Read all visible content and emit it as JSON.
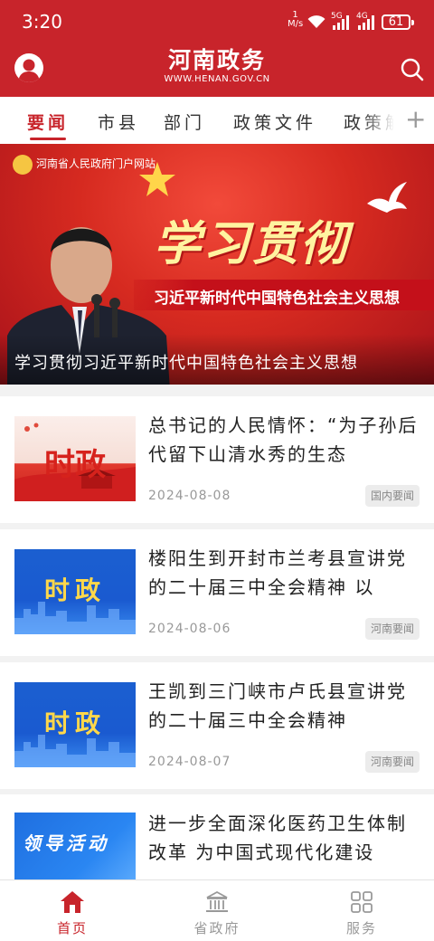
{
  "status_bar": {
    "time": "3:20",
    "net_speed_value": "1",
    "net_speed_unit": "M/s",
    "sim1_label": "5G",
    "sim2_label": "4G",
    "battery": "61"
  },
  "header": {
    "title": "河南政务",
    "subtitle": "WWW.HENAN.GOV.CN",
    "avatar_icon": "user-icon",
    "search_icon": "search-icon"
  },
  "tabs": {
    "items": [
      "要闻",
      "市县",
      "部门",
      "政策文件",
      "政策解"
    ],
    "active_index": 0,
    "add_label": "+"
  },
  "banner": {
    "site_name": "河南省人民政府门户网站",
    "headline": "学习贯彻",
    "strip_text": "习近平新时代中国特色社会主义思想",
    "caption": "学习贯彻习近平新时代中国特色社会主义思想"
  },
  "news": [
    {
      "thumb_text": "时政",
      "title": "总书记的人民情怀：“为子孙后代留下山清水秀的生态",
      "date": "2024-08-08",
      "tag": "国内要闻"
    },
    {
      "thumb_text": "时政",
      "title": "楼阳生到开封市兰考县宣讲党的二十届三中全会精神 以",
      "date": "2024-08-06",
      "tag": "河南要闻"
    },
    {
      "thumb_text": "时政",
      "title": "王凯到三门峡市卢氏县宣讲党的二十届三中全会精神",
      "date": "2024-08-07",
      "tag": "河南要闻"
    },
    {
      "thumb_text": "领导活动",
      "title": "进一步全面深化医药卫生体制改革 为中国式现代化建设",
      "date": "",
      "tag": ""
    }
  ],
  "bottom_nav": {
    "items": [
      {
        "label": "首页",
        "icon": "home-icon"
      },
      {
        "label": "省政府",
        "icon": "government-building-icon"
      },
      {
        "label": "服务",
        "icon": "grid-services-icon"
      }
    ],
    "active_index": 0
  },
  "colors": {
    "brand_red": "#c8242b",
    "tag_gray": "#ececec"
  }
}
